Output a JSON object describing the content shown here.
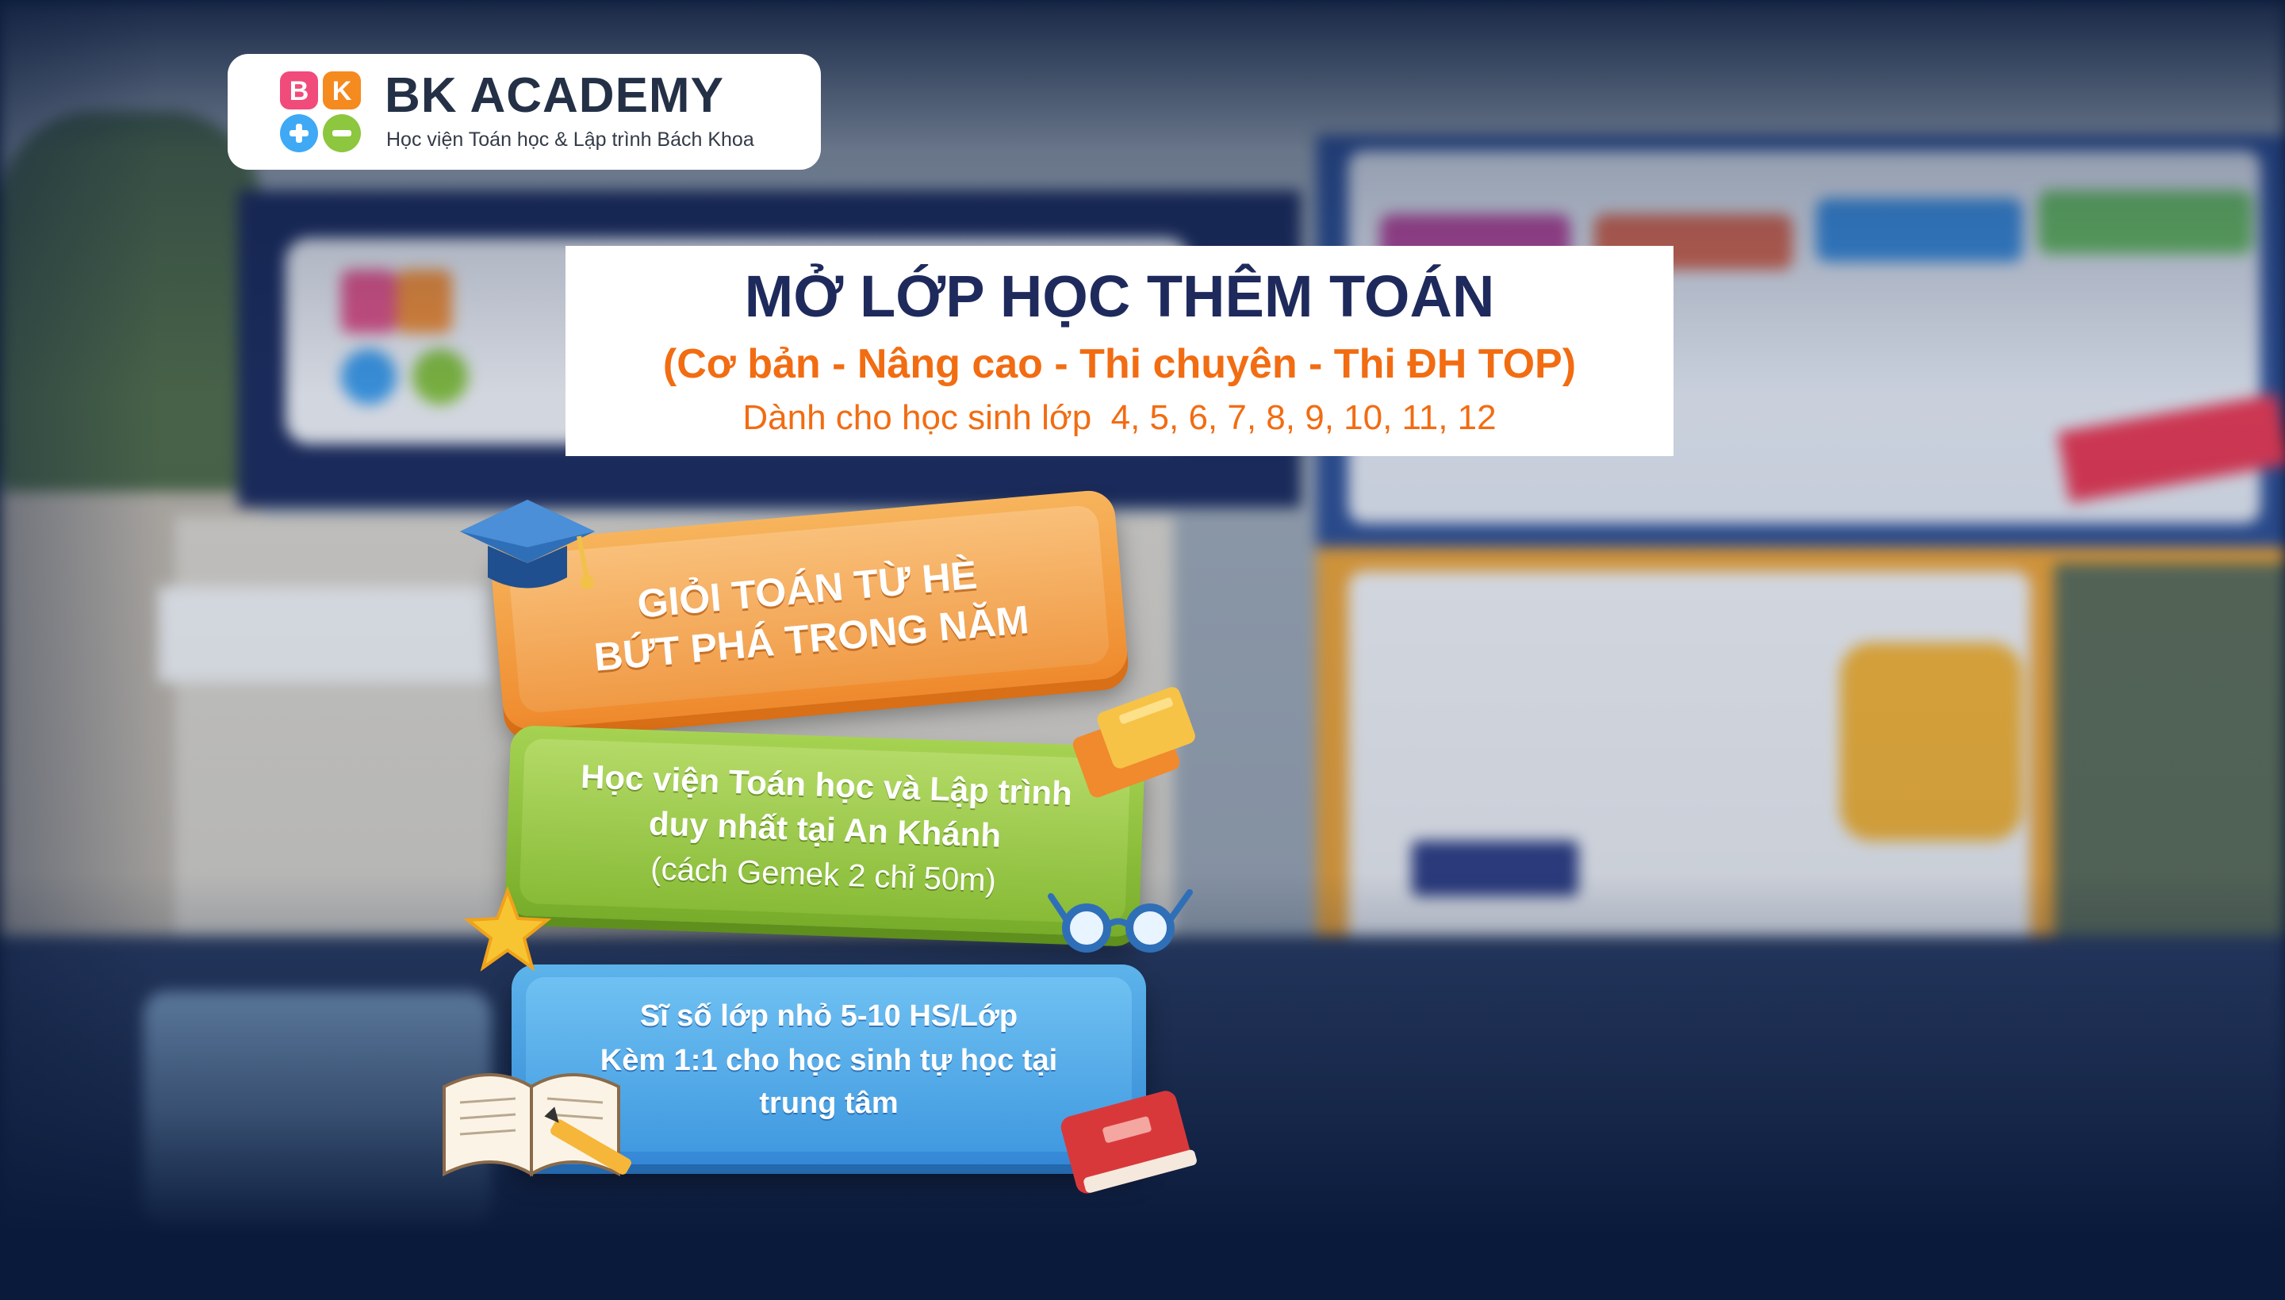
{
  "logo": {
    "title": "BK ACADEMY",
    "subtitle": "Học viện Toán học & Lập trình Bách Khoa",
    "colors": [
      "#f04b7a",
      "#f58a1f",
      "#3fa9f5",
      "#8dc63f"
    ]
  },
  "headline": {
    "title": "MỞ LỚP HỌC THÊM TOÁN",
    "levels": "(Cơ bản - Nâng cao - Thi chuyên - Thi ĐH TOP)",
    "grades": "Dành cho học sinh lớp  4, 5, 6, 7, 8, 9, 10, 11, 12"
  },
  "cards": {
    "orange": {
      "line1": "GIỎI TOÁN TỪ HÈ",
      "line2": "BỨT PHÁ TRONG NĂM",
      "color": "#ef8a2d"
    },
    "green": {
      "line1": "Học viện Toán học và Lập trình",
      "line2": "duy nhất tại An Khánh",
      "line3": "(cách Gemek 2 chỉ 50m)",
      "color": "#88bb37"
    },
    "blue": {
      "line1": "Sĩ số lớp nhỏ 5-10 HS/Lớp",
      "line2": "Kèm 1:1 cho học sinh tự học tại",
      "line3": "trung tâm",
      "color": "#419ae0"
    }
  },
  "theme": {
    "navy": "#0a1a3a",
    "title_navy": "#1f2a5c",
    "accent_orange": "#f26c12"
  }
}
